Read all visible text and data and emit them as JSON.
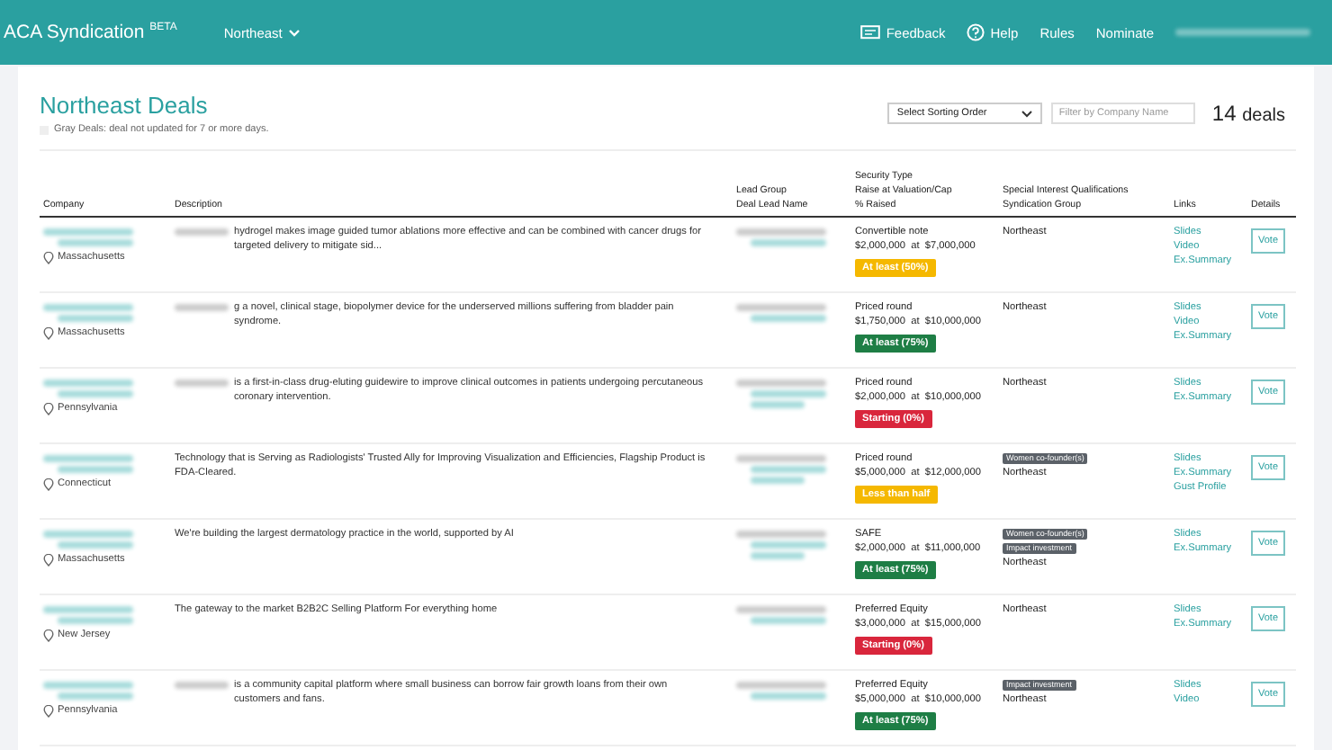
{
  "nav": {
    "brand": "ACA Syndication",
    "brand_sup": "BETA",
    "region": "Northeast",
    "links": [
      {
        "kind": "feedback",
        "label": "Feedback"
      },
      {
        "kind": "help",
        "label": "Help"
      },
      {
        "kind": "plain",
        "label": "Rules"
      },
      {
        "kind": "plain",
        "label": "Nominate"
      }
    ]
  },
  "header": {
    "title": "Northeast Deals",
    "note": "Gray Deals: deal not updated for 7 or more days.",
    "sort_placeholder": "Select Sorting Order",
    "filter_placeholder": "Filter by Company Name",
    "count": "14",
    "count_label": "deals"
  },
  "columns": [
    [
      "Company"
    ],
    [
      "Description"
    ],
    [
      "Lead Group",
      "Deal Lead Name"
    ],
    [
      "Security Type",
      "Raise at Valuation/Cap",
      "% Raised"
    ],
    [
      "Special Interest Qualifications",
      "Syndication Group"
    ],
    [
      "Links"
    ],
    [
      "Details"
    ]
  ],
  "rows": [
    {
      "state": "Massachusetts",
      "redacted_prefix": true,
      "description": "hydrogel makes image guided tumor ablations more effective and can be combined with cancer drugs for targeted delivery to mitigate sid...",
      "extra_lead_line": false,
      "security": "Convertible note",
      "raise": "$2,000,000  at  $7,000,000",
      "status": {
        "label": "At least (50%)",
        "color": "#f5b800"
      },
      "tags": [],
      "group": "Northeast",
      "links": [
        "Slides",
        "Video",
        "Ex.Summary"
      ],
      "action": "Vote"
    },
    {
      "state": "Massachusetts",
      "redacted_prefix": true,
      "description": "g a novel, clinical stage, biopolymer device for the underserved millions suffering from bladder pain syndrome.",
      "extra_lead_line": false,
      "security": "Priced round",
      "raise": "$1,750,000  at  $10,000,000",
      "status": {
        "label": "At least (75%)",
        "color": "#1e7e45"
      },
      "tags": [],
      "group": "Northeast",
      "links": [
        "Slides",
        "Video",
        "Ex.Summary"
      ],
      "action": "Vote"
    },
    {
      "state": "Pennsylvania",
      "redacted_prefix": true,
      "description": "is a first-in-class drug-eluting guidewire to improve clinical outcomes in patients undergoing percutaneous coronary intervention.",
      "extra_lead_line": true,
      "security": "Priced round",
      "raise": "$2,000,000  at  $10,000,000",
      "status": {
        "label": "Starting (0%)",
        "color": "#d9263c"
      },
      "tags": [],
      "group": "Northeast",
      "links": [
        "Slides",
        "Ex.Summary"
      ],
      "action": "Vote"
    },
    {
      "state": "Connecticut",
      "redacted_prefix": false,
      "description": "Technology that is Serving as Radiologists' Trusted Ally for Improving Visualization and Efficiencies, Flagship Product is FDA-Cleared.",
      "extra_lead_line": true,
      "security": "Priced round",
      "raise": "$5,000,000  at  $12,000,000",
      "status": {
        "label": "Less than half",
        "color": "#f5b800"
      },
      "tags": [
        "Women co-founder(s)"
      ],
      "group": "Northeast",
      "links": [
        "Slides",
        "Ex.Summary",
        "Gust Profile"
      ],
      "action": "Vote"
    },
    {
      "state": "Massachusetts",
      "redacted_prefix": false,
      "description": "We're building the largest dermatology practice in the world, supported by AI",
      "extra_lead_line": true,
      "security": "SAFE",
      "raise": "$2,000,000  at  $11,000,000",
      "status": {
        "label": "At least (75%)",
        "color": "#1e7e45"
      },
      "tags": [
        "Women co-founder(s)",
        "Impact investment"
      ],
      "group": "Northeast",
      "links": [
        "Slides",
        "Ex.Summary"
      ],
      "action": "Vote"
    },
    {
      "state": "New Jersey",
      "redacted_prefix": false,
      "description": "The gateway to the market B2B2C Selling Platform For everything home",
      "extra_lead_line": false,
      "security": "Preferred Equity",
      "raise": "$3,000,000  at  $15,000,000",
      "status": {
        "label": "Starting (0%)",
        "color": "#d9263c"
      },
      "tags": [],
      "group": "Northeast",
      "links": [
        "Slides",
        "Ex.Summary"
      ],
      "action": "Vote"
    },
    {
      "state": "Pennsylvania",
      "redacted_prefix": true,
      "description": "is a community capital platform where small business can borrow fair growth loans from their own customers and fans.",
      "extra_lead_line": false,
      "security": "Preferred Equity",
      "raise": "$5,000,000  at  $10,000,000",
      "status": {
        "label": "At least (75%)",
        "color": "#1e7e45"
      },
      "tags": [
        "Impact investment"
      ],
      "group": "Northeast",
      "links": [
        "Slides",
        "Video"
      ],
      "action": "Vote"
    }
  ]
}
